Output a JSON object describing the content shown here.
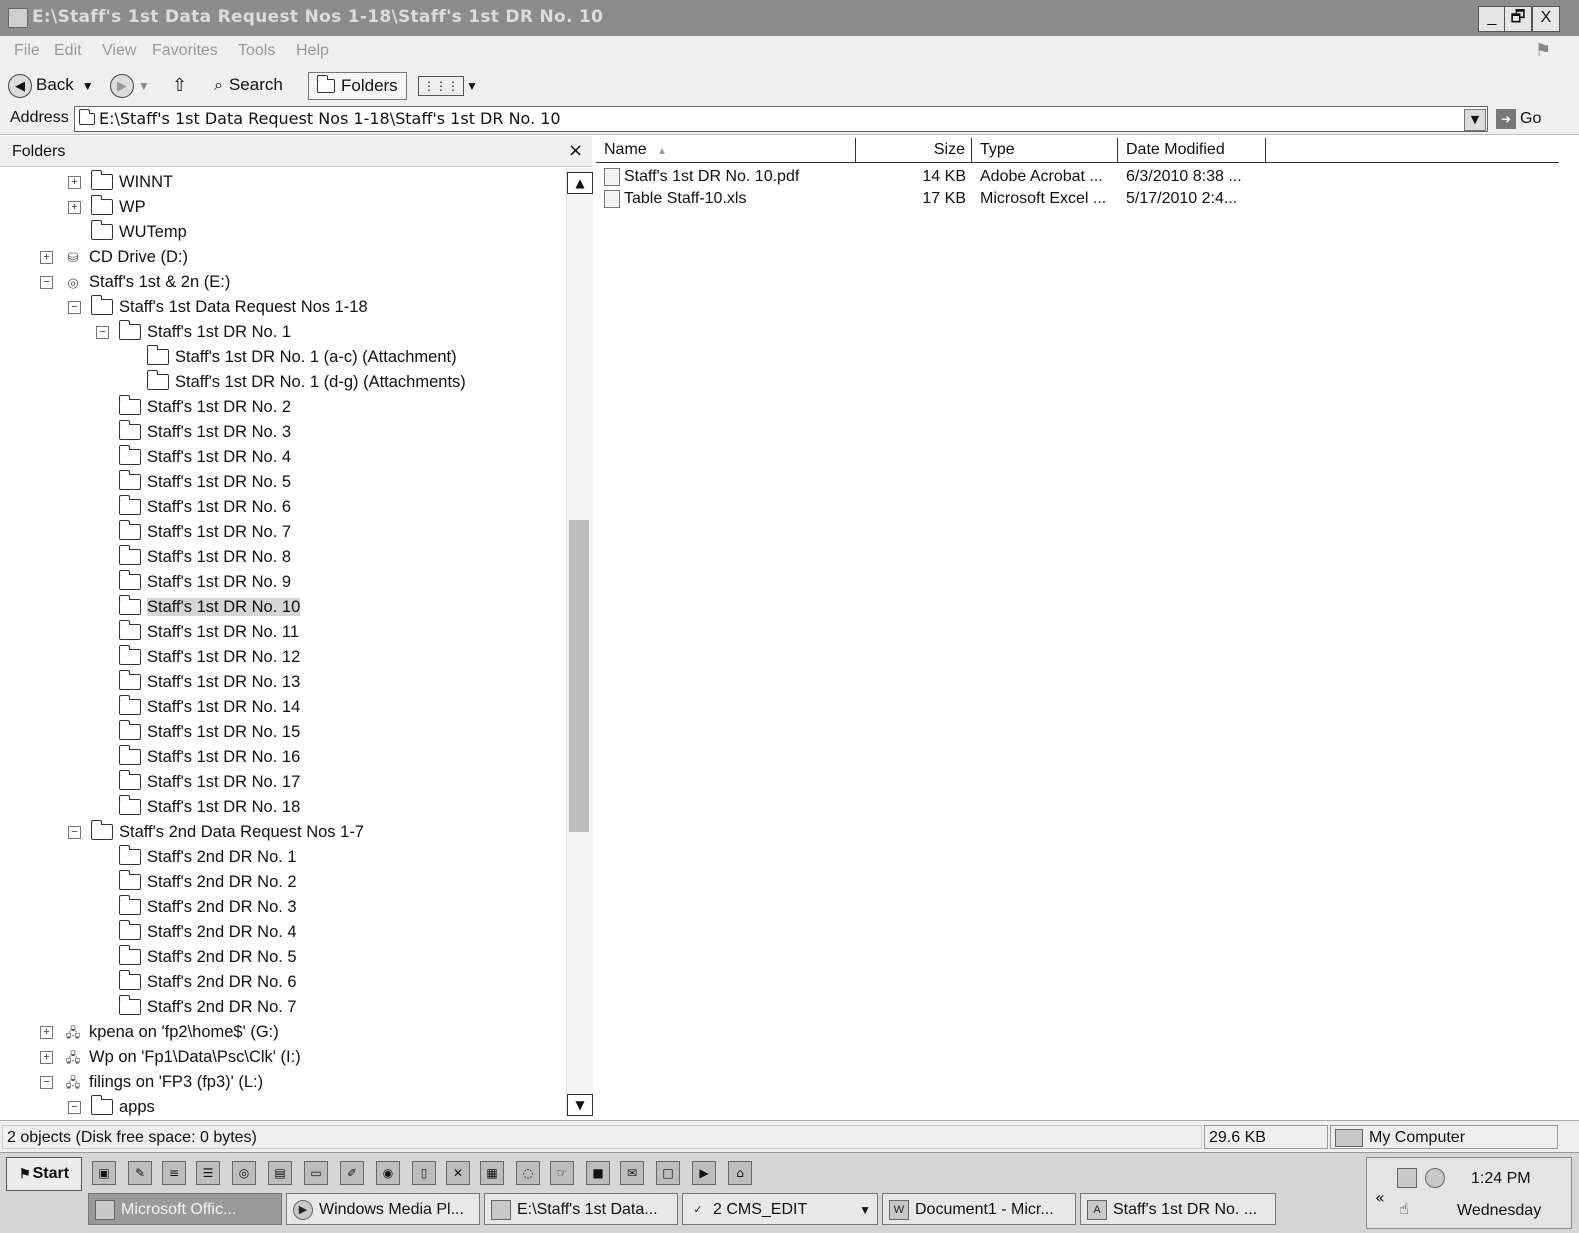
{
  "window": {
    "title": "E:\\Staff's 1st Data Request Nos 1-18\\Staff's 1st DR No. 10",
    "controls": {
      "minimize": "_",
      "restore": "🗗",
      "close": "X"
    }
  },
  "menu": [
    "File",
    "Edit",
    "View",
    "Favorites",
    "Tools",
    "Help"
  ],
  "toolbar": {
    "back_label": "Back",
    "search_label": "Search",
    "folders_label": "Folders"
  },
  "address": {
    "label": "Address",
    "value": "E:\\Staff's 1st Data Request Nos 1-18\\Staff's 1st DR No. 10",
    "go_label": "Go"
  },
  "folders_pane": {
    "title": "Folders",
    "close": "×",
    "tree": [
      {
        "label": "WINNT",
        "indent": 2,
        "toggle": "+",
        "icon": "folder"
      },
      {
        "label": "WP",
        "indent": 2,
        "toggle": "+",
        "icon": "folder"
      },
      {
        "label": "WUTemp",
        "indent": 2,
        "toggle": "",
        "icon": "folder"
      },
      {
        "label": "CD Drive (D:)",
        "indent": 1,
        "toggle": "+",
        "icon": "cd-drive"
      },
      {
        "label": "Staff's 1st & 2n (E:)",
        "indent": 1,
        "toggle": "−",
        "icon": "disc"
      },
      {
        "label": "Staff's 1st Data Request Nos 1-18",
        "indent": 2,
        "toggle": "−",
        "icon": "folder"
      },
      {
        "label": "Staff's 1st DR No. 1",
        "indent": 3,
        "toggle": "−",
        "icon": "folder"
      },
      {
        "label": "Staff's 1st DR No. 1 (a-c) (Attachment)",
        "indent": 4,
        "toggle": "",
        "icon": "folder"
      },
      {
        "label": "Staff's 1st DR No. 1 (d-g) (Attachments)",
        "indent": 4,
        "toggle": "",
        "icon": "folder"
      },
      {
        "label": "Staff's 1st DR No. 2",
        "indent": 3,
        "toggle": "",
        "icon": "folder"
      },
      {
        "label": "Staff's 1st DR No. 3",
        "indent": 3,
        "toggle": "",
        "icon": "folder"
      },
      {
        "label": "Staff's 1st DR No. 4",
        "indent": 3,
        "toggle": "",
        "icon": "folder"
      },
      {
        "label": "Staff's 1st DR No. 5",
        "indent": 3,
        "toggle": "",
        "icon": "folder"
      },
      {
        "label": "Staff's 1st DR No. 6",
        "indent": 3,
        "toggle": "",
        "icon": "folder"
      },
      {
        "label": "Staff's 1st DR No. 7",
        "indent": 3,
        "toggle": "",
        "icon": "folder"
      },
      {
        "label": "Staff's 1st DR No. 8",
        "indent": 3,
        "toggle": "",
        "icon": "folder"
      },
      {
        "label": "Staff's 1st DR No. 9",
        "indent": 3,
        "toggle": "",
        "icon": "folder"
      },
      {
        "label": "Staff's 1st DR No. 10",
        "indent": 3,
        "toggle": "",
        "icon": "folder",
        "selected": true
      },
      {
        "label": "Staff's 1st DR No. 11",
        "indent": 3,
        "toggle": "",
        "icon": "folder"
      },
      {
        "label": "Staff's 1st DR No. 12",
        "indent": 3,
        "toggle": "",
        "icon": "folder"
      },
      {
        "label": "Staff's 1st DR No. 13",
        "indent": 3,
        "toggle": "",
        "icon": "folder"
      },
      {
        "label": "Staff's 1st DR No. 14",
        "indent": 3,
        "toggle": "",
        "icon": "folder"
      },
      {
        "label": "Staff's 1st DR No. 15",
        "indent": 3,
        "toggle": "",
        "icon": "folder"
      },
      {
        "label": "Staff's 1st DR No. 16",
        "indent": 3,
        "toggle": "",
        "icon": "folder"
      },
      {
        "label": "Staff's 1st DR No. 17",
        "indent": 3,
        "toggle": "",
        "icon": "folder"
      },
      {
        "label": "Staff's 1st DR No. 18",
        "indent": 3,
        "toggle": "",
        "icon": "folder"
      },
      {
        "label": "Staff's 2nd Data Request Nos 1-7",
        "indent": 2,
        "toggle": "−",
        "icon": "folder"
      },
      {
        "label": "Staff's 2nd DR No. 1",
        "indent": 3,
        "toggle": "",
        "icon": "folder"
      },
      {
        "label": "Staff's 2nd DR No. 2",
        "indent": 3,
        "toggle": "",
        "icon": "folder"
      },
      {
        "label": "Staff's 2nd DR No. 3",
        "indent": 3,
        "toggle": "",
        "icon": "folder"
      },
      {
        "label": "Staff's 2nd DR No. 4",
        "indent": 3,
        "toggle": "",
        "icon": "folder"
      },
      {
        "label": "Staff's 2nd DR No. 5",
        "indent": 3,
        "toggle": "",
        "icon": "folder"
      },
      {
        "label": "Staff's 2nd DR No. 6",
        "indent": 3,
        "toggle": "",
        "icon": "folder"
      },
      {
        "label": "Staff's 2nd DR No. 7",
        "indent": 3,
        "toggle": "",
        "icon": "folder"
      },
      {
        "label": "kpena on 'fp2\\home$' (G:)",
        "indent": 1,
        "toggle": "+",
        "icon": "network-drive"
      },
      {
        "label": "Wp on 'Fp1\\Data\\Psc\\Clk' (I:)",
        "indent": 1,
        "toggle": "+",
        "icon": "network-drive"
      },
      {
        "label": "filings on 'FP3 (fp3)' (L:)",
        "indent": 1,
        "toggle": "−",
        "icon": "network-drive"
      },
      {
        "label": "apps",
        "indent": 2,
        "toggle": "−",
        "icon": "folder"
      }
    ]
  },
  "file_list": {
    "columns": [
      "Name",
      "Size",
      "Type",
      "Date Modified"
    ],
    "sort_indicator": "▲",
    "rows": [
      {
        "name": "Staff's 1st DR No. 10.pdf",
        "size": "14 KB",
        "type": "Adobe Acrobat ...",
        "date": "6/3/2010 8:38 ...",
        "icon": "pdf-file-icon"
      },
      {
        "name": "Table Staff-10.xls",
        "size": "17 KB",
        "type": "Microsoft Excel ...",
        "date": "5/17/2010 2:4...",
        "icon": "excel-file-icon"
      }
    ]
  },
  "status": {
    "objects": "2 objects (Disk free space: 0 bytes)",
    "size": "29.6 KB",
    "zone": "My Computer"
  },
  "taskbar": {
    "start_label": "Start",
    "tasks": [
      {
        "label": "Microsoft Offic...",
        "active": true
      },
      {
        "label": "Windows Media Pl...",
        "active": false
      },
      {
        "label": "E:\\Staff's 1st Data...",
        "active": false
      },
      {
        "label": "2 CMS_EDIT",
        "active": false
      },
      {
        "label": "Document1 - Micr...",
        "active": false
      },
      {
        "label": "Staff's 1st DR No. ...",
        "active": false
      }
    ],
    "clock_time": "1:24 PM",
    "clock_day": "Wednesday",
    "tray_chevron": "«"
  }
}
